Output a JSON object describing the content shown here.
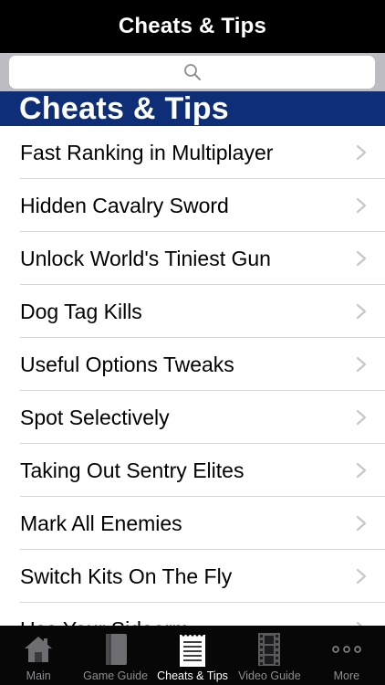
{
  "navbar": {
    "title": "Cheats & Tips"
  },
  "search": {
    "icon": "search-icon"
  },
  "section": {
    "header": "Cheats & Tips"
  },
  "list": {
    "items": [
      {
        "label": "Fast Ranking in Multiplayer"
      },
      {
        "label": "Hidden Cavalry Sword"
      },
      {
        "label": "Unlock World's Tiniest Gun"
      },
      {
        "label": "Dog Tag Kills"
      },
      {
        "label": "Useful Options Tweaks"
      },
      {
        "label": "Spot Selectively"
      },
      {
        "label": "Taking Out Sentry Elites"
      },
      {
        "label": "Mark All Enemies"
      },
      {
        "label": "Switch Kits On The Fly"
      },
      {
        "label": "Use Your Sidearm"
      }
    ]
  },
  "tabbar": {
    "tabs": [
      {
        "label": "Main",
        "icon": "house-icon",
        "active": false
      },
      {
        "label": "Game Guide",
        "icon": "book-icon",
        "active": false
      },
      {
        "label": "Cheats & Tips",
        "icon": "notepad-icon",
        "active": true
      },
      {
        "label": "Video Guide",
        "icon": "film-icon",
        "active": false
      },
      {
        "label": "More",
        "icon": "more-icon",
        "active": false
      }
    ]
  },
  "colors": {
    "navbar_bg": "#000000",
    "section_header_bg": "#0e2f78",
    "search_area_bg": "#bcbcc2",
    "tab_active": "#ffffff",
    "tab_inactive": "#8e8e93"
  }
}
